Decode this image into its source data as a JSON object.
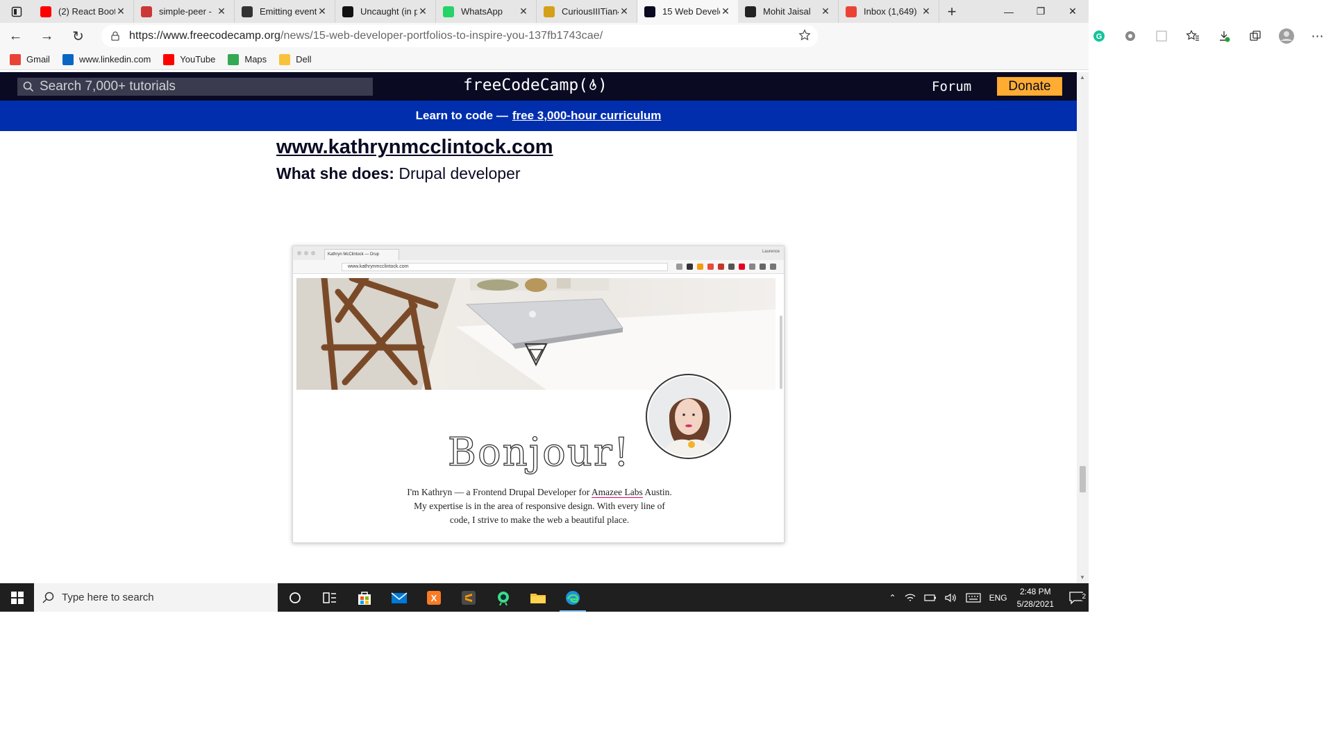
{
  "browser": {
    "tabs": [
      {
        "title": "(2) React Boot",
        "favicon": "youtube-icon",
        "color": "#ff0000"
      },
      {
        "title": "simple-peer -",
        "favicon": "npm-icon",
        "color": "#cb3837"
      },
      {
        "title": "Emitting event",
        "favicon": "compass-icon",
        "color": "#333333"
      },
      {
        "title": "Uncaught (in p",
        "favicon": "github-icon",
        "color": "#111111"
      },
      {
        "title": "WhatsApp",
        "favicon": "whatsapp-icon",
        "color": "#25d366"
      },
      {
        "title": "CuriousIIITian4",
        "favicon": "coin-icon",
        "color": "#d4a017"
      },
      {
        "title": "15 Web Develo",
        "favicon": "freecodecamp-icon",
        "color": "#0a0a23"
      },
      {
        "title": "Mohit Jaisal",
        "favicon": "person-icon",
        "color": "#222222"
      },
      {
        "title": "Inbox (1,649)",
        "favicon": "gmail-icon",
        "color": "#ea4335"
      }
    ],
    "url_host": "https://www.freecodecamp.org",
    "url_path": "/news/15-web-developer-portfolios-to-inspire-you-137fb1743cae/",
    "bookmarks": [
      {
        "label": "Gmail",
        "icon": "gmail-icon"
      },
      {
        "label": "www.linkedin.com",
        "icon": "linkedin-icon"
      },
      {
        "label": "YouTube",
        "icon": "youtube-icon"
      },
      {
        "label": "Maps",
        "icon": "maps-icon"
      },
      {
        "label": "Dell",
        "icon": "folder-icon"
      }
    ]
  },
  "fcc": {
    "search_placeholder": "Search 7,000+ tutorials",
    "logo_text": "freeCodeCamp(",
    "logo_close": ")",
    "forum": "Forum",
    "donate": "Donate",
    "banner_text": "Learn to code —",
    "banner_link": "free 3,000-hour curriculum"
  },
  "article": {
    "link": "www.kathrynmcclintock.com",
    "what_label": "What she does:",
    "what_value": " Drupal developer"
  },
  "screenshot": {
    "tab_title": "Kathryn McClintock — Drup",
    "user": "Laurence",
    "url": "www.kathrynmcclintock.com",
    "heading": "Bonjour!",
    "bio_1": "I'm Kathryn — a Frontend Drupal Developer for ",
    "bio_link": "Amazee Labs",
    "bio_2": " Austin. My expertise is in the area of responsive design. With every line of code, I strive to make the web a beautiful place."
  },
  "taskbar": {
    "search_placeholder": "Type here to search",
    "language": "ENG",
    "time": "2:48 PM",
    "date": "5/28/2021",
    "notifications": "2"
  }
}
